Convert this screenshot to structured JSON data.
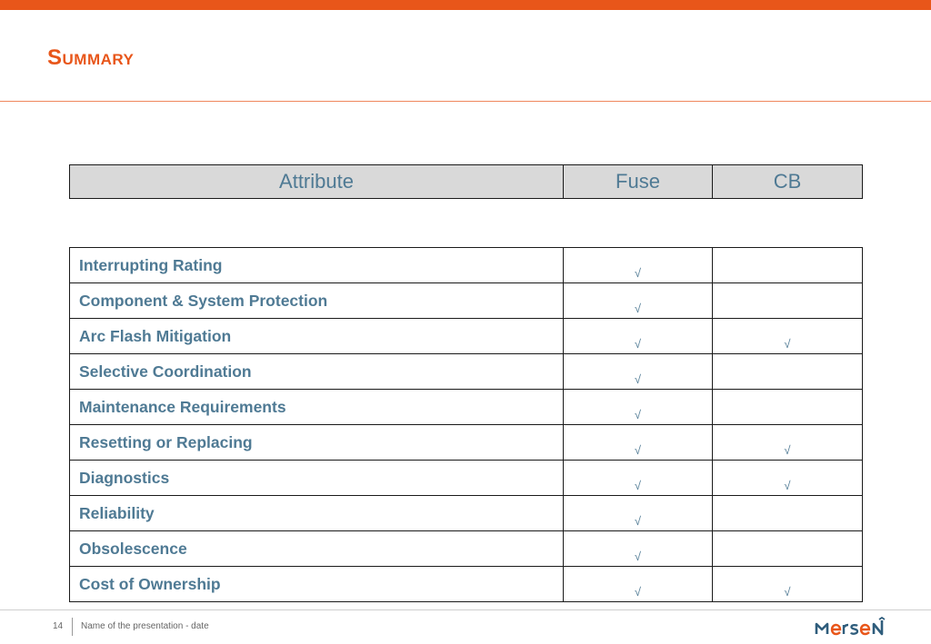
{
  "slide": {
    "title": "Summary",
    "page_number": "14",
    "footer_text": "Name of the presentation - date",
    "logo_text": "MERSEN",
    "accent_color": "#e8561a",
    "text_color": "#4f7a94"
  },
  "header": {
    "attribute": "Attribute",
    "fuse": "Fuse",
    "cb": "CB"
  },
  "rows": [
    {
      "attribute": "Interrupting Rating",
      "fuse": "√",
      "cb": ""
    },
    {
      "attribute": "Component & System Protection",
      "fuse": "√",
      "cb": ""
    },
    {
      "attribute": "Arc Flash Mitigation",
      "fuse": "√",
      "cb": "√"
    },
    {
      "attribute": "Selective Coordination",
      "fuse": "√",
      "cb": ""
    },
    {
      "attribute": "Maintenance Requirements",
      "fuse": "√",
      "cb": ""
    },
    {
      "attribute": "Resetting or Replacing",
      "fuse": "√",
      "cb": "√"
    },
    {
      "attribute": "Diagnostics",
      "fuse": "√",
      "cb": "√"
    },
    {
      "attribute": "Reliability",
      "fuse": "√",
      "cb": ""
    },
    {
      "attribute": "Obsolescence",
      "fuse": "√",
      "cb": ""
    },
    {
      "attribute": "Cost of Ownership",
      "fuse": "√",
      "cb": "√"
    }
  ]
}
